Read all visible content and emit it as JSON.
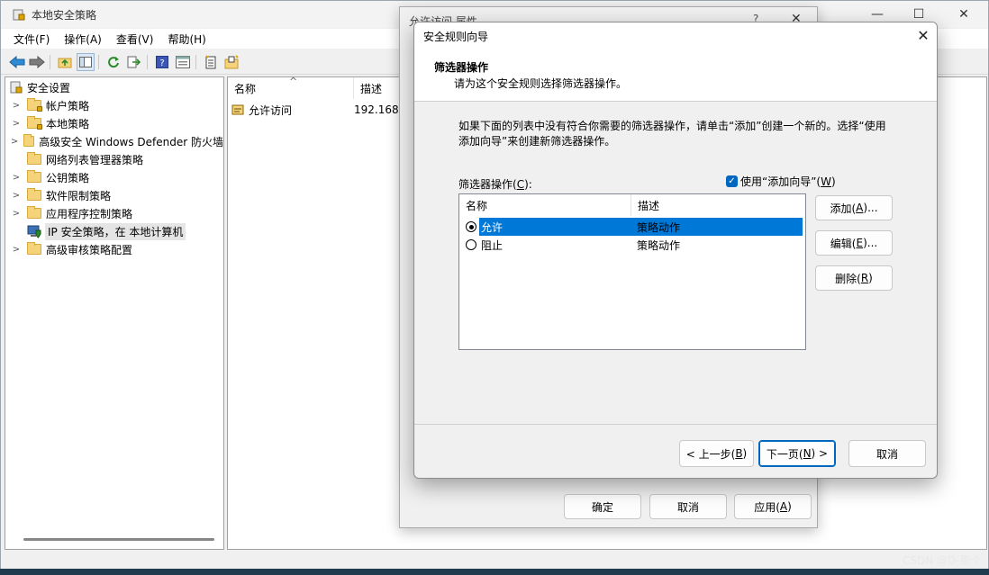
{
  "main_window": {
    "title": "本地安全策略",
    "caption": {
      "minimize": "—",
      "maximize": "☐",
      "close": "✕"
    },
    "menu": [
      {
        "label": "文件(F)"
      },
      {
        "label": "操作(A)"
      },
      {
        "label": "查看(V)"
      },
      {
        "label": "帮助(H)"
      }
    ]
  },
  "tree": {
    "root": "安全设置",
    "items": [
      {
        "label": "帐户策略",
        "expandable": true
      },
      {
        "label": "本地策略",
        "expandable": true
      },
      {
        "label": "高级安全 Windows Defender 防火墙",
        "expandable": true
      },
      {
        "label": "网络列表管理器策略",
        "expandable": false
      },
      {
        "label": "公钥策略",
        "expandable": true
      },
      {
        "label": "软件限制策略",
        "expandable": true
      },
      {
        "label": "应用程序控制策略",
        "expandable": true
      },
      {
        "label": "IP 安全策略，在 本地计算机",
        "expandable": false,
        "selected": true
      },
      {
        "label": "高级审核策略配置",
        "expandable": true
      }
    ]
  },
  "list": {
    "columns": [
      "名称",
      "描述"
    ],
    "sort_arrow": "^",
    "rows": [
      {
        "name": "允许访问",
        "desc": "192.168"
      }
    ]
  },
  "properties_dialog": {
    "title": "允许访问 属性",
    "help_glyph": "?",
    "close_glyph": "✕",
    "buttons": {
      "ok": "确定",
      "cancel": "取消",
      "apply": "应用(",
      "apply_key": "A",
      "apply_end": ")"
    }
  },
  "wizard": {
    "title": "安全规则向导",
    "close_glyph": "✕",
    "heading": "筛选器操作",
    "subheading": "请为这个安全规则选择筛选器操作。",
    "description": "如果下面的列表中没有符合你需要的筛选器操作，请单击“添加”创建一个新的。选择“使用添加向导”来创建新筛选器操作。",
    "filter_label_pre": "筛选器操作(",
    "filter_label_key": "C",
    "filter_label_post": "):",
    "use_wizard_pre": "使用“添加向导”(",
    "use_wizard_key": "W",
    "use_wizard_post": ")",
    "use_wizard_checked": true,
    "check_glyph": "✓",
    "columns": [
      "名称",
      "描述"
    ],
    "filter_actions": [
      {
        "name": "允许",
        "desc": "策略动作",
        "selected": true
      },
      {
        "name": "阻止",
        "desc": "策略动作",
        "selected": false
      }
    ],
    "side_buttons": {
      "add_pre": "添加(",
      "add_key": "A",
      "add_post": ")...",
      "edit_pre": "编辑(",
      "edit_key": "E",
      "edit_post": ")...",
      "remove_pre": "删除(",
      "remove_key": "R",
      "remove_post": ")"
    },
    "nav_buttons": {
      "back_pre": "< 上一步(",
      "back_key": "B",
      "back_post": ")",
      "next_pre": "下一页(",
      "next_key": "N",
      "next_post": ") >",
      "cancel": "取消"
    }
  },
  "watermark": "CSDN @D-那个",
  "colors": {
    "selection": "#0078d7",
    "accent": "#0067c0"
  }
}
